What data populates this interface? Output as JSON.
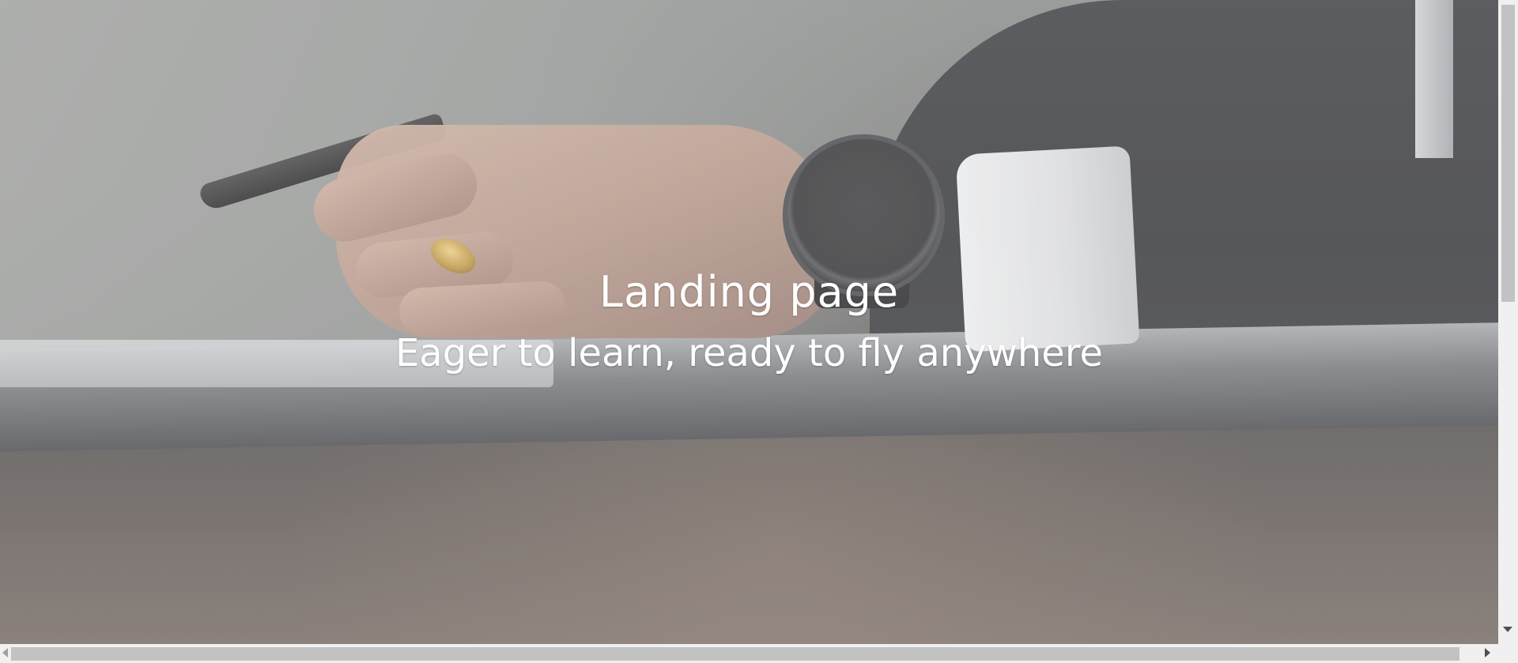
{
  "hero": {
    "title": "Landing page",
    "subtitle": "Eager to learn, ready to fly anywhere"
  },
  "colors": {
    "text": "#ffffff",
    "overlay": "rgba(255,255,255,0.22)",
    "scrollbar_track": "#f0f0f0",
    "scrollbar_thumb": "#c2c2c2"
  }
}
